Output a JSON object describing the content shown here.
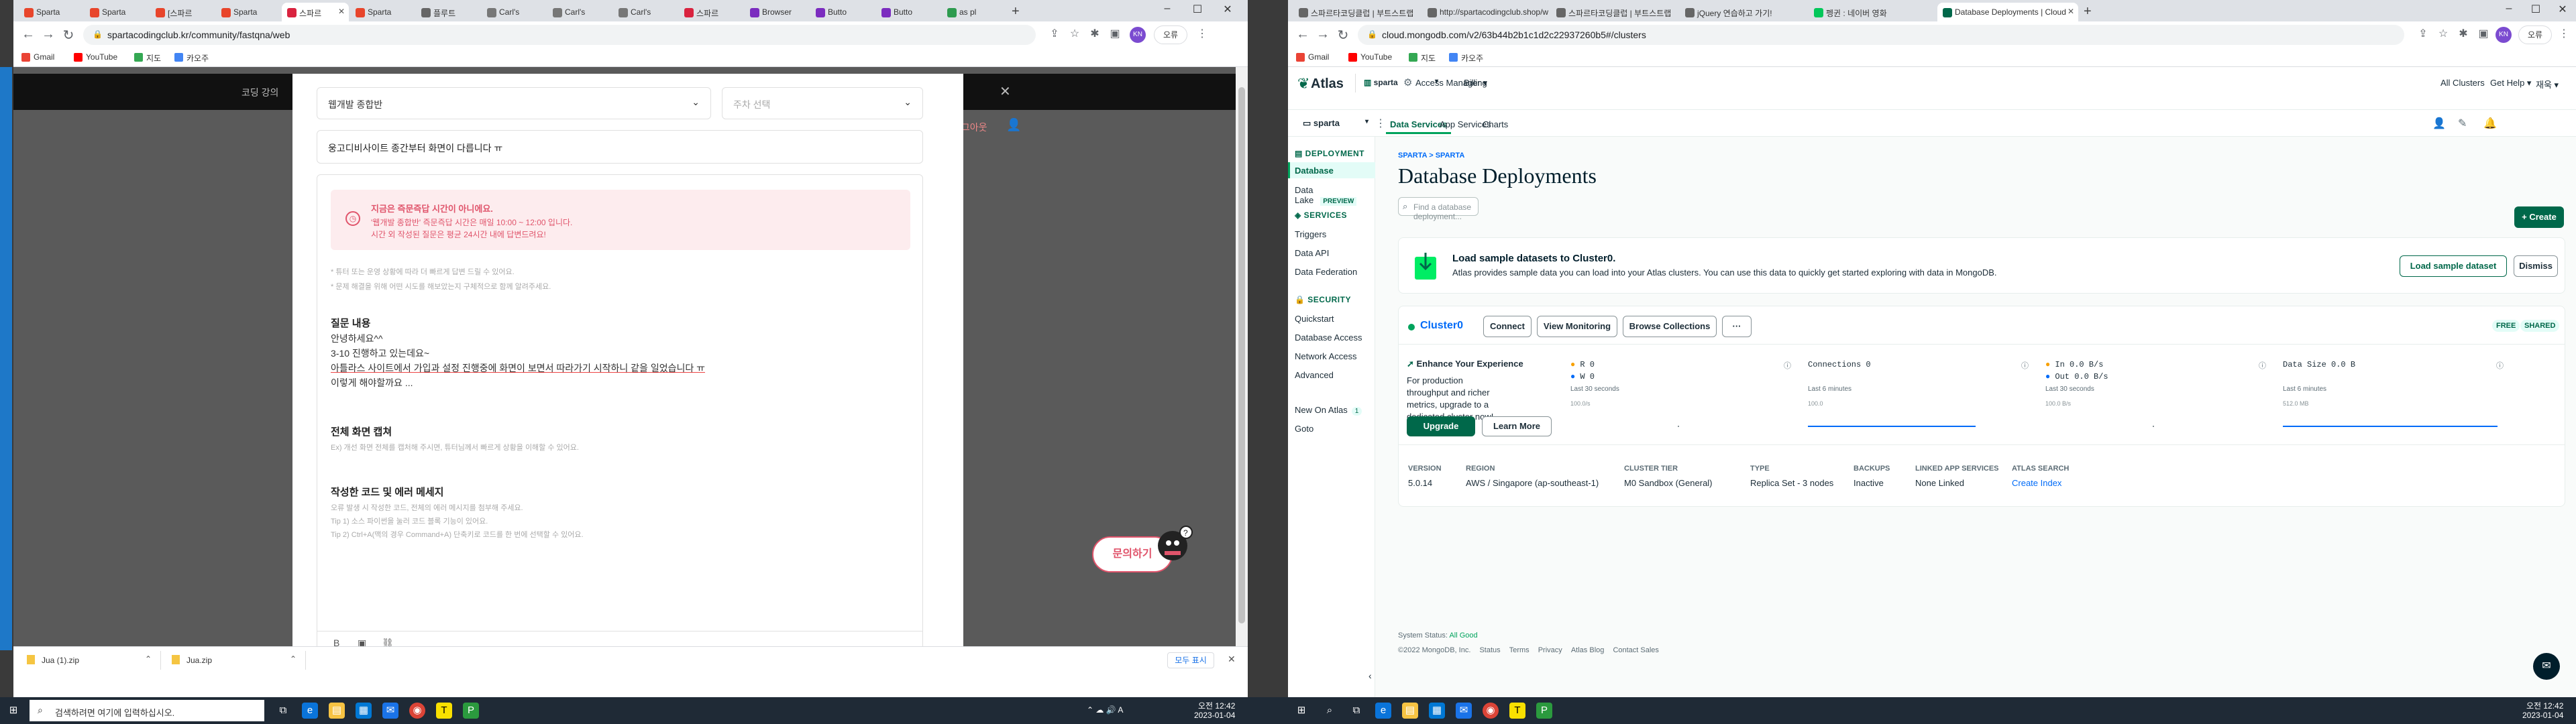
{
  "left": {
    "tabs": [
      "Sparta",
      "Sparta",
      "[스파르",
      "Sparta",
      "스파르",
      "Sparta",
      "플루트",
      "Carl's",
      "Carl's",
      "Carl's",
      "스파르",
      "Browser",
      "Butto",
      "Butto",
      "as pl"
    ],
    "url": "spartacodingclub.kr/community/fastqna/web",
    "bookmarks": [
      "Gmail",
      "YouTube",
      "지도",
      "카오주"
    ],
    "banner_text": "코딩 강의",
    "category_select": "웹개발 종합반",
    "week_select": "주차 선택",
    "title_value": "웅고디비사이트 종간부터 화면이 다릅니다 ㅠ",
    "notice_title": "지금은 즉문즉답 시간이 아니에요.",
    "notice_body1": "'웹개발 종합반' 즉문즉답 시간은 매일 10:00 ~ 12:00 입니다.",
    "notice_body2": "시간 외 작성된 질문은 평균 24시간 내에 답변드려요!",
    "hint1": "* 튜터 또는 운영 상황에 따라 더 빠르게 답변 드릴 수 있어요.",
    "hint2": "* 문제 해결을 위해 어떤 시도를 해보았는지 구체적으로 함께 알려주세요.",
    "q_header": "질문 내용",
    "q_lines": [
      "안녕하세요^^",
      "3-10 진행하고 있는데요~",
      "아틀라스 사이트에서 가입과 설정 진행중에 화면이 보면서 따라가기 시작하니 같을 일었습니다 ㅠ",
      "이렇게 해야할까요 ..."
    ],
    "capture_header": "전체 화면 캡쳐",
    "capture_hint": "Ex) 개선 화면 전체를 캡처해 주시면, 튜터님께서 빠르게 상황을 이해할 수 있어요.",
    "code_header": "작성한 코드 및 에러 메세지",
    "code_hints": [
      "오류 발생 시 작성한 코드, 전체의 에러 메시지를 첨부해 주세요.",
      "Tip 1) 소스 파이썬을 눌러 코드 블록 기능이 있어요.",
      "Tip 2) Ctrl+A(맥의 경우 Command+A) 단축키로 코드를 한 번에 선택할 수 있어요."
    ],
    "ask_button": "문의하기",
    "downloads": [
      "Jua (1).zip",
      "Jua.zip"
    ],
    "show_all": "모두 표시",
    "search_placeholder": "검색하려면 여기에 입력하십시오.",
    "clock_time": "오전 12:42",
    "clock_date": "2023-01-04"
  },
  "right": {
    "tabs": [
      "스파르타코딩클럽 | 부트스트랩",
      "http://spartacodingclub.shop/w",
      "스파르타코딩클럽 | 부트스트랩",
      "jQuery 연습하고 가기!",
      "펭귄 : 네이버 영화",
      "Database Deployments | Cloud"
    ],
    "url": "cloud.mongodb.com/v2/63b44b2b1c1d2c22937260b5#/clusters",
    "bookmarks": [
      "Gmail",
      "YouTube",
      "지도",
      "카오주"
    ],
    "logo": "Atlas",
    "org": "sparta",
    "access_manager": "Access Manager",
    "billing": "Billing",
    "all_clusters": "All Clusters",
    "get_help": "Get Help",
    "user": "재욱",
    "project": "sparta",
    "subnav": [
      "Data Services",
      "App Services",
      "Charts"
    ],
    "side_deployment": "DEPLOYMENT",
    "side_database": "Database",
    "side_datalake": "Data Lake",
    "preview": "PREVIEW",
    "side_services": "SERVICES",
    "side_services_items": [
      "Triggers",
      "Data API",
      "Data Federation"
    ],
    "side_security": "SECURITY",
    "side_security_items": [
      "Quickstart",
      "Database Access",
      "Network Access",
      "Advanced"
    ],
    "side_new": "New On Atlas",
    "side_new_count": "1",
    "side_goto": "Goto",
    "breadcrumb": "SPARTA > SPARTA",
    "heading": "Database Deployments",
    "find_placeholder": "Find a database deployment...",
    "create": "+ Create",
    "sample_title": "Load sample datasets to Cluster0.",
    "sample_body": "Atlas provides sample data you can load into your Atlas clusters. You can use this data to quickly get started exploring with data in MongoDB.",
    "load_sample": "Load sample dataset",
    "dismiss": "Dismiss",
    "cluster_name": "Cluster0",
    "connect": "Connect",
    "view_monitoring": "View Monitoring",
    "browse_collections": "Browse Collections",
    "more": "···",
    "free": "FREE",
    "shared": "SHARED",
    "enhance_title": "Enhance Your Experience",
    "enhance_body": "For production throughput and richer metrics, upgrade to a dedicated cluster now!",
    "upgrade": "Upgrade",
    "learn_more": "Learn More",
    "metric_r": "R  0",
    "metric_w": "W  0",
    "metric_last1": "Last 30 seconds",
    "metric_scale1": "100.0/s",
    "connections": "Connections  0",
    "metric_last2": "Last 6 minutes",
    "metric_scale2": "100.0",
    "net_in": "In  0.0 B/s",
    "net_out": "Out  0.0 B/s",
    "metric_last3": "Last 30 seconds",
    "metric_scale3": "100.0 B/s",
    "data_size": "Data Size  0.0 B",
    "metric_last4": "Last 6 minutes",
    "metric_scale4": "512.0 MB",
    "props": [
      {
        "label": "VERSION",
        "value": "5.0.14"
      },
      {
        "label": "REGION",
        "value": "AWS / Singapore (ap-southeast-1)"
      },
      {
        "label": "CLUSTER TIER",
        "value": "M0 Sandbox (General)"
      },
      {
        "label": "TYPE",
        "value": "Replica Set - 3 nodes"
      },
      {
        "label": "BACKUPS",
        "value": "Inactive"
      },
      {
        "label": "LINKED APP SERVICES",
        "value": "None Linked"
      },
      {
        "label": "ATLAS SEARCH",
        "value": "Create Index"
      }
    ],
    "status": "System Status:",
    "status_value": "All Good",
    "footer": "©2022 MongoDB, Inc.",
    "footer_links": [
      "Status",
      "Terms",
      "Privacy",
      "Atlas Blog",
      "Contact Sales"
    ],
    "clock_time": "오전 12:42",
    "clock_date": "2023-01-04"
  }
}
